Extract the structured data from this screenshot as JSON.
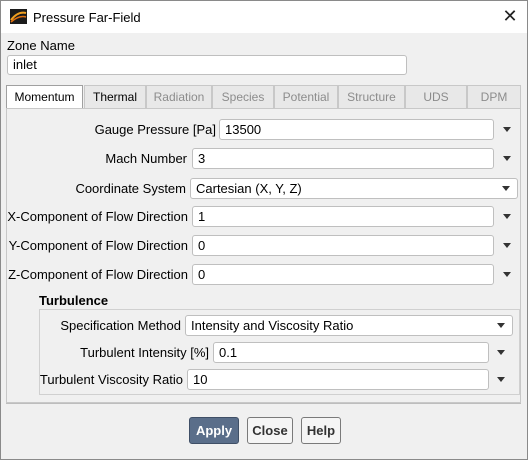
{
  "window": {
    "title": "Pressure Far-Field",
    "close_symbol": "✕"
  },
  "zone": {
    "label": "Zone Name",
    "value": "inlet"
  },
  "tabs": [
    {
      "label": "Momentum",
      "state": "active"
    },
    {
      "label": "Thermal",
      "state": "normal"
    },
    {
      "label": "Radiation",
      "state": "disabled"
    },
    {
      "label": "Species",
      "state": "disabled"
    },
    {
      "label": "Potential",
      "state": "disabled"
    },
    {
      "label": "Structure",
      "state": "disabled"
    },
    {
      "label": "UDS",
      "state": "disabled"
    },
    {
      "label": "DPM",
      "state": "disabled"
    }
  ],
  "momentum": {
    "gauge_pressure": {
      "label": "Gauge Pressure [Pa]",
      "value": "13500"
    },
    "mach_number": {
      "label": "Mach Number",
      "value": "3"
    },
    "coordinate_system": {
      "label": "Coordinate System",
      "value": "Cartesian (X, Y, Z)"
    },
    "x_component": {
      "label": "X-Component of Flow Direction",
      "value": "1"
    },
    "y_component": {
      "label": "Y-Component of Flow Direction",
      "value": "0"
    },
    "z_component": {
      "label": "Z-Component of Flow Direction",
      "value": "0"
    }
  },
  "turbulence": {
    "title": "Turbulence",
    "specification_method": {
      "label": "Specification Method",
      "value": "Intensity and Viscosity Ratio"
    },
    "intensity": {
      "label": "Turbulent Intensity [%]",
      "value": "0.1"
    },
    "viscosity_ratio": {
      "label": "Turbulent Viscosity Ratio",
      "value": "10"
    }
  },
  "buttons": {
    "apply": "Apply",
    "close": "Close",
    "help": "Help"
  },
  "colors": {
    "primary_button": "#5a6e8a",
    "disabled_tab_text": "#8c8c8c"
  }
}
